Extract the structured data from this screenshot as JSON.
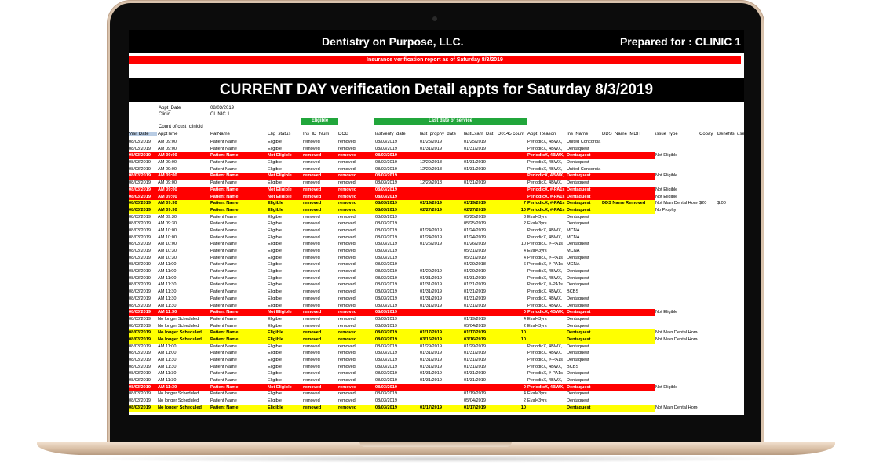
{
  "report": {
    "company": "Dentistry on Purpose, LLC.",
    "prepared_for": "Prepared for : CLINIC 1",
    "subtitle": "Insurance verification report as of Saturday 8/3/2019",
    "title": "CURRENT DAY verification Detail appts for Saturday 8/3/2019"
  },
  "meta": {
    "appt_date_label": "Appt_Date",
    "appt_date_value": "08/03/2019",
    "clinic_label": "Clinic",
    "clinic_value": "CLINIC 1",
    "count_label": "Count of cust_clinicid",
    "eligible_label": "Eligible",
    "last_service_label": "Last date of service"
  },
  "headers": [
    "Visit Date",
    "ApptTime",
    "PatName",
    "Elig_status",
    "Ins_ID_Num",
    "DOB",
    "lastverify_date",
    "last_prophy_date",
    "lastExam_Dat",
    "D0145 count",
    "Appt_Reason",
    "Ins_Name",
    "DDS_Name_MDH",
    "issue_type",
    "Copay",
    "Benefits_used"
  ],
  "rows": [
    {
      "style": "normal",
      "cells": [
        "08/03/2019",
        "AM 09:00",
        "Patient Name",
        "Eligible",
        "removed",
        "removed",
        "08/03/2019",
        "01/25/2019",
        "01/25/2019",
        "",
        "PeriodicX, 4BWX,",
        "United Concordia",
        "",
        "",
        "",
        ""
      ]
    },
    {
      "style": "normal",
      "cells": [
        "08/03/2019",
        "AM 09:00",
        "Patient Name",
        "Eligible",
        "removed",
        "removed",
        "08/03/2019",
        "01/31/2019",
        "01/31/2019",
        "",
        "PeriodicX, 4BWX,",
        "Dentaquest",
        "",
        "",
        "",
        ""
      ]
    },
    {
      "style": "red",
      "cells": [
        "08/03/2019",
        "AM 09:00",
        "Patient Name",
        "Not Eligible",
        "removed",
        "removed",
        "08/03/2019",
        "",
        "",
        "",
        "PeriodicX, 4BWX,",
        "Dentaquest",
        "",
        "Not Eligible",
        "",
        ""
      ]
    },
    {
      "style": "normal",
      "cells": [
        "08/03/2019",
        "AM 09:00",
        "Patient Name",
        "Eligible",
        "removed",
        "removed",
        "08/03/2019",
        "12/29/2018",
        "01/31/2019",
        "",
        "PeriodicX, 4BWX,",
        "Dentaquest",
        "",
        "",
        "",
        ""
      ]
    },
    {
      "style": "normal",
      "cells": [
        "08/03/2019",
        "AM 09:00",
        "Patient Name",
        "Eligible",
        "removed",
        "removed",
        "08/03/2019",
        "12/29/2018",
        "01/31/2019",
        "",
        "PeriodicX, 4BWX,",
        "United Concordia",
        "",
        "",
        "",
        ""
      ]
    },
    {
      "style": "red",
      "cells": [
        "08/03/2019",
        "AM 09:00",
        "Patient Name",
        "Not Eligible",
        "removed",
        "removed",
        "08/03/2019",
        "",
        "",
        "",
        "PeriodicX, 4BWX,",
        "Dentaquest",
        "",
        "Not Eligible",
        "",
        ""
      ]
    },
    {
      "style": "normal",
      "cells": [
        "08/03/2019",
        "AM 09:00",
        "Patient Name",
        "Eligible",
        "removed",
        "removed",
        "08/03/2019",
        "12/29/2018",
        "01/31/2019",
        "",
        "PeriodicX, 4BWX,",
        "Dentaquest",
        "",
        "",
        "",
        ""
      ]
    },
    {
      "style": "red",
      "cells": [
        "08/03/2019",
        "AM 09:00",
        "Patient Name",
        "Not Eligible",
        "removed",
        "removed",
        "08/03/2019",
        "",
        "",
        "",
        "PeriodicX, #-PA1s",
        "Dentaquest",
        "",
        "Not Eligible",
        "",
        ""
      ]
    },
    {
      "style": "red",
      "cells": [
        "08/03/2019",
        "AM 09:00",
        "Patient Name",
        "Not Eligible",
        "removed",
        "removed",
        "08/03/2019",
        "",
        "",
        "",
        "PeriodicX, #-PA1s",
        "Dentaquest",
        "",
        "Not Eligible",
        "",
        ""
      ]
    },
    {
      "style": "yellow",
      "cells": [
        "08/03/2019",
        "AM 09:30",
        "Patient Name",
        "Eligible",
        "removed",
        "removed",
        "08/03/2019",
        "01/19/2019",
        "01/19/2019",
        "7",
        "PeriodicX, #-PA1s",
        "Dentaquest",
        "DDS Name Removed",
        "Not Main Dental Home",
        "$20",
        "$.00"
      ]
    },
    {
      "style": "yellow",
      "cells": [
        "08/03/2019",
        "AM 09:30",
        "Patient Name",
        "Eligible",
        "removed",
        "removed",
        "08/03/2019",
        "02/27/2019",
        "02/27/2019",
        "10",
        "PeriodicX, #-PA1s",
        "Dentaquest",
        "",
        "No Prophy",
        "",
        ""
      ]
    },
    {
      "style": "normal",
      "cells": [
        "08/03/2019",
        "AM 09:30",
        "Patient Name",
        "Eligible",
        "removed",
        "removed",
        "08/03/2019",
        "",
        "05/25/2019",
        "3",
        "Eval<3yrs",
        "Dentaquest",
        "",
        "",
        "",
        ""
      ]
    },
    {
      "style": "normal",
      "cells": [
        "08/03/2019",
        "AM 09:30",
        "Patient Name",
        "Eligible",
        "removed",
        "removed",
        "08/03/2019",
        "",
        "05/25/2019",
        "2",
        "Eval<3yrs",
        "Dentaquest",
        "",
        "",
        "",
        ""
      ]
    },
    {
      "style": "normal",
      "cells": [
        "08/03/2019",
        "AM 10:00",
        "Patient Name",
        "Eligible",
        "removed",
        "removed",
        "08/03/2019",
        "01/24/2019",
        "01/24/2019",
        "",
        "PeriodicX, 4BWX,",
        "MCNA",
        "",
        "",
        "",
        ""
      ]
    },
    {
      "style": "normal",
      "cells": [
        "08/03/2019",
        "AM 10:00",
        "Patient Name",
        "Eligible",
        "removed",
        "removed",
        "08/03/2019",
        "01/24/2019",
        "01/24/2019",
        "",
        "PeriodicX, 4BWX,",
        "MCNA",
        "",
        "",
        "",
        ""
      ]
    },
    {
      "style": "normal",
      "cells": [
        "08/03/2019",
        "AM 10:00",
        "Patient Name",
        "Eligible",
        "removed",
        "removed",
        "08/03/2019",
        "01/26/2019",
        "01/26/2019",
        "10",
        "PeriodicX, #-PA1s",
        "Dentaquest",
        "",
        "",
        "",
        ""
      ]
    },
    {
      "style": "normal",
      "cells": [
        "08/03/2019",
        "AM 10:30",
        "Patient Name",
        "Eligible",
        "removed",
        "removed",
        "08/03/2019",
        "",
        "05/31/2019",
        "4",
        "Eval<3yrs",
        "MCNA",
        "",
        "",
        "",
        ""
      ]
    },
    {
      "style": "normal",
      "cells": [
        "08/03/2019",
        "AM 10:30",
        "Patient Name",
        "Eligible",
        "removed",
        "removed",
        "08/03/2019",
        "",
        "05/31/2019",
        "4",
        "PeriodicX, #-PA1s",
        "Dentaquest",
        "",
        "",
        "",
        ""
      ]
    },
    {
      "style": "normal",
      "cells": [
        "08/03/2019",
        "AM 11:00",
        "Patient Name",
        "Eligible",
        "removed",
        "removed",
        "08/03/2019",
        "",
        "01/29/2018",
        "6",
        "PeriodicX, #-PA1s",
        "MCNA",
        "",
        "",
        "",
        ""
      ]
    },
    {
      "style": "normal",
      "cells": [
        "08/03/2019",
        "AM 11:00",
        "Patient Name",
        "Eligible",
        "removed",
        "removed",
        "08/03/2019",
        "01/29/2019",
        "01/29/2019",
        "",
        "PeriodicX, 4BWX,",
        "Dentaquest",
        "",
        "",
        "",
        ""
      ]
    },
    {
      "style": "normal",
      "cells": [
        "08/03/2019",
        "AM 11:00",
        "Patient Name",
        "Eligible",
        "removed",
        "removed",
        "08/03/2019",
        "01/31/2019",
        "01/31/2019",
        "",
        "PeriodicX, 4BWX,",
        "Dentaquest",
        "",
        "",
        "",
        ""
      ]
    },
    {
      "style": "normal",
      "cells": [
        "08/03/2019",
        "AM 11:30",
        "Patient Name",
        "Eligible",
        "removed",
        "removed",
        "08/03/2019",
        "01/31/2019",
        "01/31/2019",
        "",
        "PeriodicX, #-PA1s",
        "Dentaquest",
        "",
        "",
        "",
        ""
      ]
    },
    {
      "style": "normal",
      "cells": [
        "08/03/2019",
        "AM 11:30",
        "Patient Name",
        "Eligible",
        "removed",
        "removed",
        "08/03/2019",
        "01/31/2019",
        "01/31/2019",
        "",
        "PeriodicX, 4BWX,",
        "BCBS",
        "",
        "",
        "",
        ""
      ]
    },
    {
      "style": "normal",
      "cells": [
        "08/03/2019",
        "AM 11:30",
        "Patient Name",
        "Eligible",
        "removed",
        "removed",
        "08/03/2019",
        "01/31/2019",
        "01/31/2019",
        "",
        "PeriodicX, 4BWX,",
        "Dentaquest",
        "",
        "",
        "",
        ""
      ]
    },
    {
      "style": "normal",
      "cells": [
        "08/03/2019",
        "AM 11:30",
        "Patient Name",
        "Eligible",
        "removed",
        "removed",
        "08/03/2019",
        "01/31/2019",
        "01/31/2019",
        "",
        "PeriodicX, 4BWX,",
        "Dentaquest",
        "",
        "",
        "",
        ""
      ]
    },
    {
      "style": "red",
      "cells": [
        "08/03/2019",
        "AM 11:30",
        "Patient Name",
        "Not Eligible",
        "removed",
        "removed",
        "08/03/2019",
        "",
        "",
        "0",
        "PeriodicX, 4BWX,",
        "Dentaquest",
        "",
        "Not Eligible",
        "",
        ""
      ]
    },
    {
      "style": "normal",
      "cells": [
        "08/03/2019",
        "No longer Scheduled",
        "Patient Name",
        "Eligible",
        "removed",
        "removed",
        "08/03/2019",
        "",
        "01/19/2019",
        "4",
        "Eval<3yrs",
        "Dentaquest",
        "",
        "",
        "",
        ""
      ]
    },
    {
      "style": "normal",
      "cells": [
        "08/03/2019",
        "No longer Scheduled",
        "Patient Name",
        "Eligible",
        "removed",
        "removed",
        "08/03/2019",
        "",
        "05/04/2019",
        "2",
        "Eval<3yrs",
        "Dentaquest",
        "",
        "",
        "",
        ""
      ]
    },
    {
      "style": "yellow",
      "cells": [
        "08/03/2019",
        "No longer Scheduled",
        "Patient Name",
        "Eligible",
        "removed",
        "removed",
        "08/03/2019",
        "01/17/2019",
        "01/17/2019",
        "10",
        "",
        "Dentaquest",
        "",
        "Not Main Dental Home",
        "",
        ""
      ]
    },
    {
      "style": "yellow",
      "cells": [
        "08/03/2019",
        "No longer Scheduled",
        "Patient Name",
        "Eligible",
        "removed",
        "removed",
        "08/03/2019",
        "03/16/2019",
        "03/16/2019",
        "10",
        "",
        "Dentaquest",
        "",
        "Not Main Dental Home",
        "",
        ""
      ]
    },
    {
      "style": "normal",
      "cells": [
        "08/03/2019",
        "AM 11:00",
        "Patient Name",
        "Eligible",
        "removed",
        "removed",
        "08/03/2019",
        "01/29/2019",
        "01/29/2019",
        "",
        "PeriodicX, 4BWX,",
        "Dentaquest",
        "",
        "",
        "",
        ""
      ]
    },
    {
      "style": "normal",
      "cells": [
        "08/03/2019",
        "AM 11:00",
        "Patient Name",
        "Eligible",
        "removed",
        "removed",
        "08/03/2019",
        "01/31/2019",
        "01/31/2019",
        "",
        "PeriodicX, 4BWX,",
        "Dentaquest",
        "",
        "",
        "",
        ""
      ]
    },
    {
      "style": "normal",
      "cells": [
        "08/03/2019",
        "AM 11:30",
        "Patient Name",
        "Eligible",
        "removed",
        "removed",
        "08/03/2019",
        "01/31/2019",
        "01/31/2019",
        "",
        "PeriodicX, #-PA1s",
        "Dentaquest",
        "",
        "",
        "",
        ""
      ]
    },
    {
      "style": "normal",
      "cells": [
        "08/03/2019",
        "AM 11:30",
        "Patient Name",
        "Eligible",
        "removed",
        "removed",
        "08/03/2019",
        "01/31/2019",
        "01/31/2019",
        "",
        "PeriodicX, 4BWX,",
        "BCBS",
        "",
        "",
        "",
        ""
      ]
    },
    {
      "style": "normal",
      "cells": [
        "08/03/2019",
        "AM 11:30",
        "Patient Name",
        "Eligible",
        "removed",
        "removed",
        "08/03/2019",
        "01/31/2019",
        "01/31/2019",
        "",
        "PeriodicX, #-PA1s",
        "Dentaquest",
        "",
        "",
        "",
        ""
      ]
    },
    {
      "style": "normal",
      "cells": [
        "08/03/2019",
        "AM 11:30",
        "Patient Name",
        "Eligible",
        "removed",
        "removed",
        "08/03/2019",
        "01/31/2019",
        "01/31/2019",
        "",
        "PeriodicX, 4BWX,",
        "Dentaquest",
        "",
        "",
        "",
        ""
      ]
    },
    {
      "style": "red",
      "cells": [
        "08/03/2019",
        "AM 11:30",
        "Patient Name",
        "Not Eligible",
        "removed",
        "removed",
        "08/03/2019",
        "",
        "",
        "0",
        "PeriodicX, 4BWX,",
        "Dentaquest",
        "",
        "Not Eligible",
        "",
        ""
      ]
    },
    {
      "style": "normal",
      "cells": [
        "08/03/2019",
        "No longer Scheduled",
        "Patient Name",
        "Eligible",
        "removed",
        "removed",
        "08/03/2019",
        "",
        "01/19/2019",
        "4",
        "Eval<3yrs",
        "Dentaquest",
        "",
        "",
        "",
        ""
      ]
    },
    {
      "style": "normal",
      "cells": [
        "08/03/2019",
        "No longer Scheduled",
        "Patient Name",
        "Eligible",
        "removed",
        "removed",
        "08/03/2019",
        "",
        "05/04/2019",
        "2",
        "Eval<3yrs",
        "Dentaquest",
        "",
        "",
        "",
        ""
      ]
    },
    {
      "style": "yellow",
      "cells": [
        "08/03/2019",
        "No longer Scheduled",
        "Patient Name",
        "Eligible",
        "removed",
        "removed",
        "08/03/2019",
        "01/17/2019",
        "01/17/2019",
        "10",
        "",
        "Dentaquest",
        "",
        "Not Main Dental Home",
        "",
        ""
      ]
    }
  ]
}
